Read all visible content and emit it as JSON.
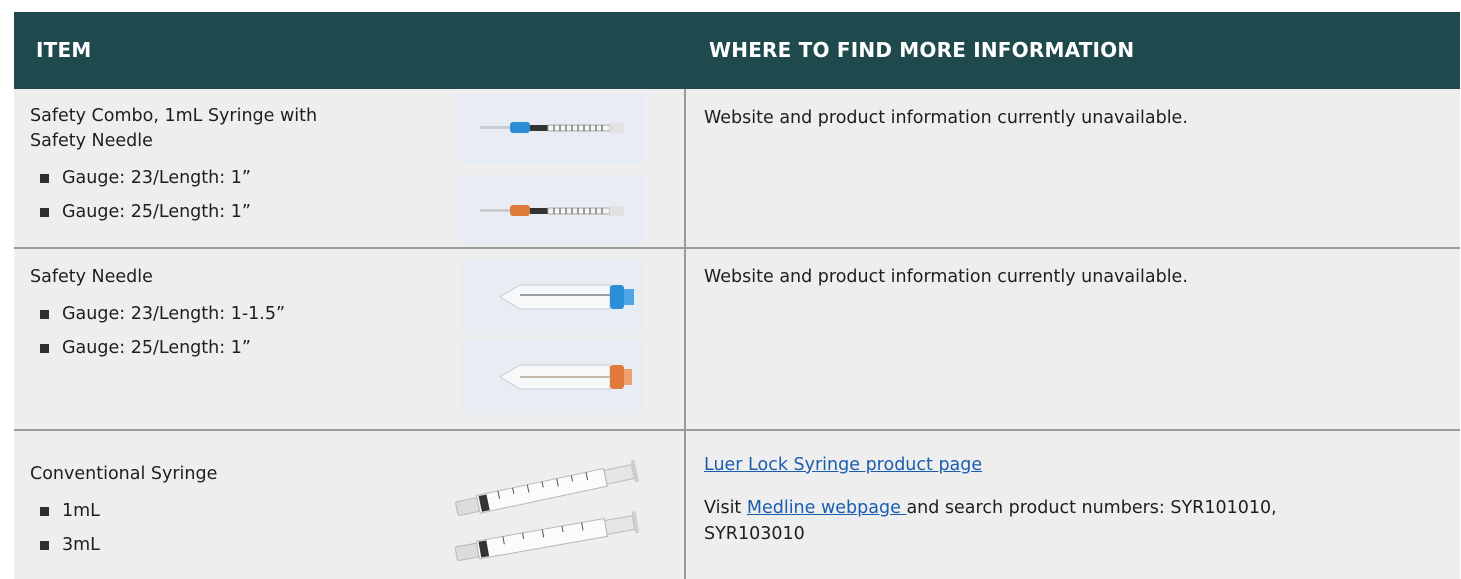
{
  "header": {
    "item": "ITEM",
    "info": "WHERE TO FIND MORE INFORMATION"
  },
  "rows": [
    {
      "title_line1": "Safety Combo, 1mL Syringe with",
      "title_line2": "Safety Needle",
      "bullets": [
        "Gauge: 23/Length: 1”",
        "Gauge: 25/Length: 1”"
      ],
      "info_text": "Website and product information currently unavailable."
    },
    {
      "title_line1": "Safety Needle",
      "bullets": [
        "Gauge: 23/Length: 1-1.5”",
        "Gauge: 25/Length: 1”"
      ],
      "info_text": "Website and product information currently unavailable."
    },
    {
      "title_line1": "Conventional Syringe",
      "bullets": [
        "1mL",
        "3mL"
      ],
      "link1": "Luer Lock Syringe product page",
      "visit": "Visit ",
      "link2": "Medline webpage ",
      "after_link2": "and search product numbers: SYR101010,",
      "line3": "SYR103010"
    }
  ],
  "colors": {
    "header_bg": "#1e4a4e",
    "row_bg": "#eeeeee",
    "link": "#1a5cb0",
    "blue_hub": "#2a8fd6",
    "orange_hub": "#e07a3a"
  }
}
